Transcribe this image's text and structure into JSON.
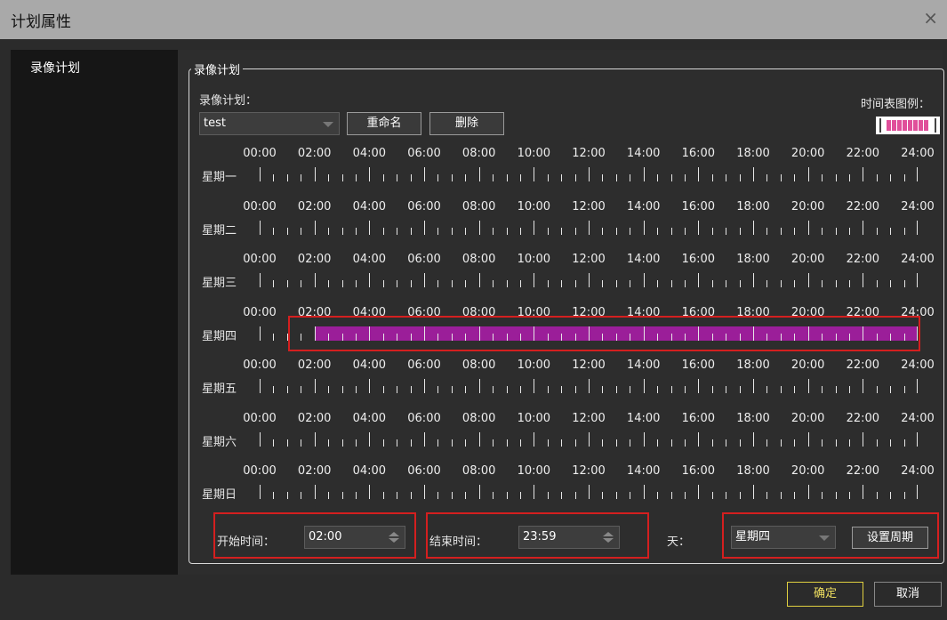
{
  "window": {
    "title": "计划属性",
    "close_glyph": "×"
  },
  "sidebar": {
    "items": [
      {
        "label": "录像计划"
      }
    ]
  },
  "group": {
    "title": "录像计划",
    "plan_label": "录像计划：",
    "plan_value": "test",
    "rename_label": "重命名",
    "delete_label": "删除",
    "legend_label": "时间表图例："
  },
  "hours": [
    "00:00",
    "02:00",
    "04:00",
    "06:00",
    "08:00",
    "10:00",
    "12:00",
    "14:00",
    "16:00",
    "18:00",
    "20:00",
    "22:00",
    "24:00"
  ],
  "days": [
    {
      "name": "星期一",
      "schedule": null
    },
    {
      "name": "星期二",
      "schedule": null
    },
    {
      "name": "星期三",
      "schedule": null
    },
    {
      "name": "星期四",
      "schedule": {
        "start_hour": 2.0,
        "end_hour": 23.98
      }
    },
    {
      "name": "星期五",
      "schedule": null
    },
    {
      "name": "星期六",
      "schedule": null
    },
    {
      "name": "星期日",
      "schedule": null
    }
  ],
  "controls": {
    "start_label": "开始时间：",
    "start_value": "02:00",
    "end_label": "结束时间：",
    "end_value": "23:59",
    "day_label": "天：",
    "day_value": "星期四",
    "set_period_label": "设置周期"
  },
  "footer": {
    "ok_label": "确定",
    "cancel_label": "取消"
  },
  "colors": {
    "schedule_fill": "#9b1e99",
    "highlight_border": "#d41f1f",
    "ok_accent": "#e0d040"
  }
}
